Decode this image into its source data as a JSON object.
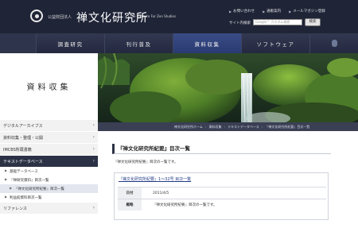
{
  "header": {
    "org_type": "公益財団法人",
    "org_name": "禅文化研究所",
    "org_name_en": "The Institute For Zen Studies",
    "util_links": [
      {
        "label": "お問い合わせ"
      },
      {
        "label": "通販案内"
      },
      {
        "label": "メールマガジン登録"
      }
    ],
    "search_label": "サイト内検索",
    "search_placeholder": "Google™ カスタム検索",
    "search_button": "検索"
  },
  "gnav": {
    "items": [
      {
        "label": "調査研究",
        "active": false
      },
      {
        "label": "刊行普及",
        "active": false
      },
      {
        "label": "資料収集",
        "active": true
      },
      {
        "label": "ソフトウェア",
        "active": false
      }
    ]
  },
  "sidebar": {
    "title": "資料収集",
    "items": [
      {
        "label": "デジタルアーカイブス"
      },
      {
        "label": "資料収集・整理・公開"
      },
      {
        "label": "IMCBS所蔵書籍"
      },
      {
        "label": "テキストデータベース"
      }
    ],
    "subitems": [
      {
        "label": "基础データベース"
      },
      {
        "label": "『禅研究資料』目次一覧"
      },
      {
        "label": "『禅文化研究所紀要』目次一覧"
      },
      {
        "label": "利益館資料目次一覧"
      }
    ],
    "last_item": {
      "label": "リファレンス"
    }
  },
  "breadcrumb": [
    "禅文化研究所ホーム",
    "資料収集",
    "テキストデータベース",
    "『禅文化研究所紀要』目次一覧"
  ],
  "main": {
    "heading": "『禅文化研究所紀要』目次一覧",
    "intro": "『禅文化研究所紀要』目次の一覧です。",
    "entry": {
      "title": "『禅文化研究所紀要』1〜32号 目次一覧",
      "rows": [
        {
          "label": "日付",
          "value": "2011/4/5"
        },
        {
          "label": "概略",
          "value": "『禅文化研究所紀要』目次の一覧です。"
        }
      ]
    }
  },
  "colors": {
    "header_bg": "#1f2437",
    "nav_active": "#2f4280",
    "sidebar_current": "#2c3246",
    "link": "#233a8a"
  }
}
